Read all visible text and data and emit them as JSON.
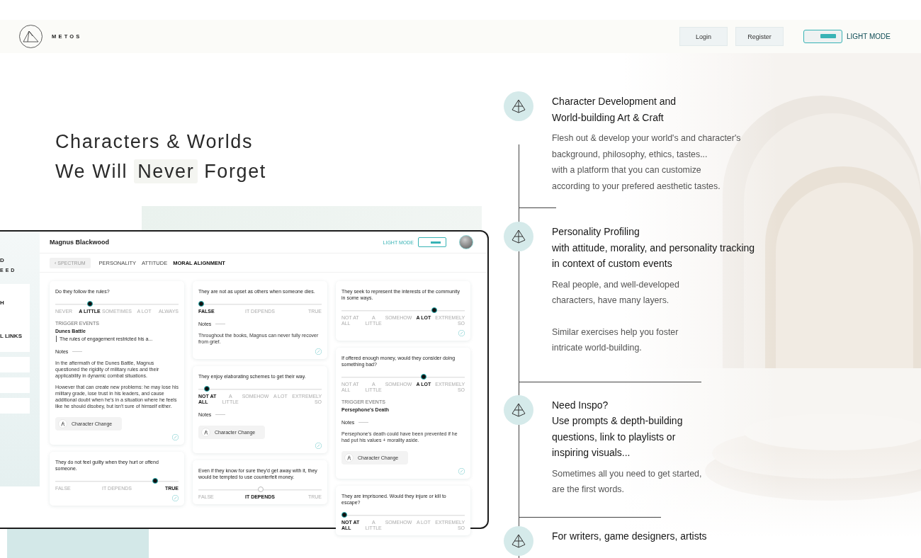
{
  "header": {
    "logo": "METOS",
    "nav_buttons": [
      "Login",
      "Register"
    ],
    "mode_toggle": {
      "label": "LIGHT MODE",
      "on": true
    }
  },
  "hero": {
    "line_1": "Characters & Worlds",
    "line_2": [
      {
        "text": "We Will",
        "highlighted": false
      },
      {
        "text": "Never",
        "highlighted": true
      },
      {
        "text": "Forget",
        "highlighted": false
      }
    ]
  },
  "mockup": {
    "sidebar": {
      "labels": [
        "D",
        "EED"
      ],
      "card_labels": [
        "H",
        "L LINKS"
      ]
    },
    "title": "Magnus Blackwood",
    "mode_toggle": {
      "label": "LIGHT MODE",
      "on": true
    },
    "back_button": "‹ SPECTRUM",
    "tabs": [
      {
        "label": "PERSONALITY",
        "selected": false
      },
      {
        "label": "ATTITUDE",
        "selected": false
      },
      {
        "label": "MORAL ALIGNMENT",
        "selected": true
      }
    ],
    "columns": [
      [
        {
          "question": "Do they follow the rules?",
          "level": 0.27,
          "marked": true,
          "options": [
            {
              "label": "NEVER",
              "selected": false
            },
            {
              "label": "A LITTLE",
              "selected": true
            },
            {
              "label": "SOMETIMES",
              "selected": false
            },
            {
              "label": "A LOT",
              "selected": false
            },
            {
              "label": "ALWAYS",
              "selected": false
            }
          ],
          "trigger_events": {
            "label": "TRIGGER EVENTS",
            "title": "Dunes Battle",
            "detail": "The rules of engagement restricted his a..."
          },
          "notes_label": "Notes",
          "notes": [
            "In the aftermath of the Dunes Battle, Magnus questioned the rigidity of military rules and their applicability in dynamic combat situations.",
            "However that can create new problems: he may lose his military grade, lose trust in his leaders, and cause additional doubt when he's in a situation where he feels like he should disobey, but isn't sure of himself either."
          ],
          "button": "Character Change",
          "edit_icon": true
        },
        {
          "question": "They do not feel guilty when they hurt or offend someone.",
          "level": 0.82,
          "marked": true,
          "options": [
            {
              "label": "FALSE",
              "selected": false
            },
            {
              "label": "IT DEPENDS",
              "selected": false
            },
            {
              "label": "TRUE",
              "selected": true
            }
          ],
          "edit_icon": true
        }
      ],
      [
        {
          "question": "They are not as upset as others when someone dies.",
          "level": 0,
          "marked": true,
          "options": [
            {
              "label": "FALSE",
              "selected": true
            },
            {
              "label": "IT DEPENDS",
              "selected": false
            },
            {
              "label": "TRUE",
              "selected": false
            }
          ],
          "notes_label": "Notes",
          "notes": [
            "Throughout the books, Magnus can never fully recover from grief."
          ],
          "edit_icon": true
        },
        {
          "question": "They enjoy elaborating schemes to get their way.",
          "level": 0.05,
          "marked": true,
          "options": [
            {
              "label": "NOT AT ALL",
              "selected": true
            },
            {
              "label": "A LITTLE",
              "selected": false
            },
            {
              "label": "SOMEHOW",
              "selected": false
            },
            {
              "label": "A LOT",
              "selected": false
            },
            {
              "label": "EXTREMELY SO",
              "selected": false
            }
          ],
          "notes_label": "Notes",
          "button": "Character Change",
          "edit_icon": true
        },
        {
          "question": "Even if they know for sure they'd get away with it, they would be tempted to use counterfeit money.",
          "level": 0.5,
          "marked": false,
          "options": [
            {
              "label": "FALSE",
              "selected": false
            },
            {
              "label": "IT DEPENDS",
              "selected": true
            },
            {
              "label": "TRUE",
              "selected": false
            }
          ]
        }
      ],
      [
        {
          "question": "They seek to represent the interests of the community in some ways.",
          "level": 0.76,
          "marked": true,
          "options": [
            {
              "label": "NOT AT ALL",
              "selected": false
            },
            {
              "label": "A LITTLE",
              "selected": false
            },
            {
              "label": "SOMEHOW",
              "selected": false
            },
            {
              "label": "A LOT",
              "selected": true
            },
            {
              "label": "EXTREMELY SO",
              "selected": false
            }
          ],
          "edit_icon": true
        },
        {
          "question": "If offered enough money, would they consider doing something bad?",
          "level": 0.67,
          "marked": true,
          "options": [
            {
              "label": "NOT AT ALL",
              "selected": false
            },
            {
              "label": "A LITTLE",
              "selected": false
            },
            {
              "label": "SOMEHOW",
              "selected": false
            },
            {
              "label": "A LOT",
              "selected": true
            },
            {
              "label": "EXTREMELY SO",
              "selected": false
            }
          ],
          "trigger_events": {
            "label": "TRIGGER EVENTS",
            "title": "Persephone's Death"
          },
          "notes_label": "Notes",
          "notes": [
            "Persephone's death could have been prevented if he had put his values + morality aside."
          ],
          "button": "Character Change",
          "edit_icon": true
        },
        {
          "question": "They are imprisoned. Would they injure or kill to escape?",
          "level": 0,
          "marked": true,
          "options": [
            {
              "label": "NOT AT ALL",
              "selected": true
            },
            {
              "label": "A LITTLE",
              "selected": false
            },
            {
              "label": "SOMEHOW",
              "selected": false
            },
            {
              "label": "A LOT",
              "selected": false
            },
            {
              "label": "EXTREMELY SO",
              "selected": false
            }
          ]
        }
      ]
    ]
  },
  "features": [
    {
      "title": "Character Development and\nWorld-building Art & Craft",
      "paragraphs": [
        "Flesh out & develop your world's and character's\nbackground, philosophy, ethics, tastes...\nwith a platform that you can customize\naccording to your prefered aesthetic tastes."
      ]
    },
    {
      "title": "Personality Profiling\nwith attitude, morality, and personality tracking\nin context of custom events",
      "paragraphs": [
        "Real people, and well-developed\ncharacters, have many layers.",
        "Similar exercises help you foster\nintricate world-building."
      ]
    },
    {
      "title": "Need Inspo?\nUse prompts & depth-building\nquestions, link to playlists or\ninspiring visuals...",
      "paragraphs": [
        "Sometimes all you need to get started,\nare the first words."
      ]
    },
    {
      "title": "For writers, game designers, artists"
    }
  ]
}
